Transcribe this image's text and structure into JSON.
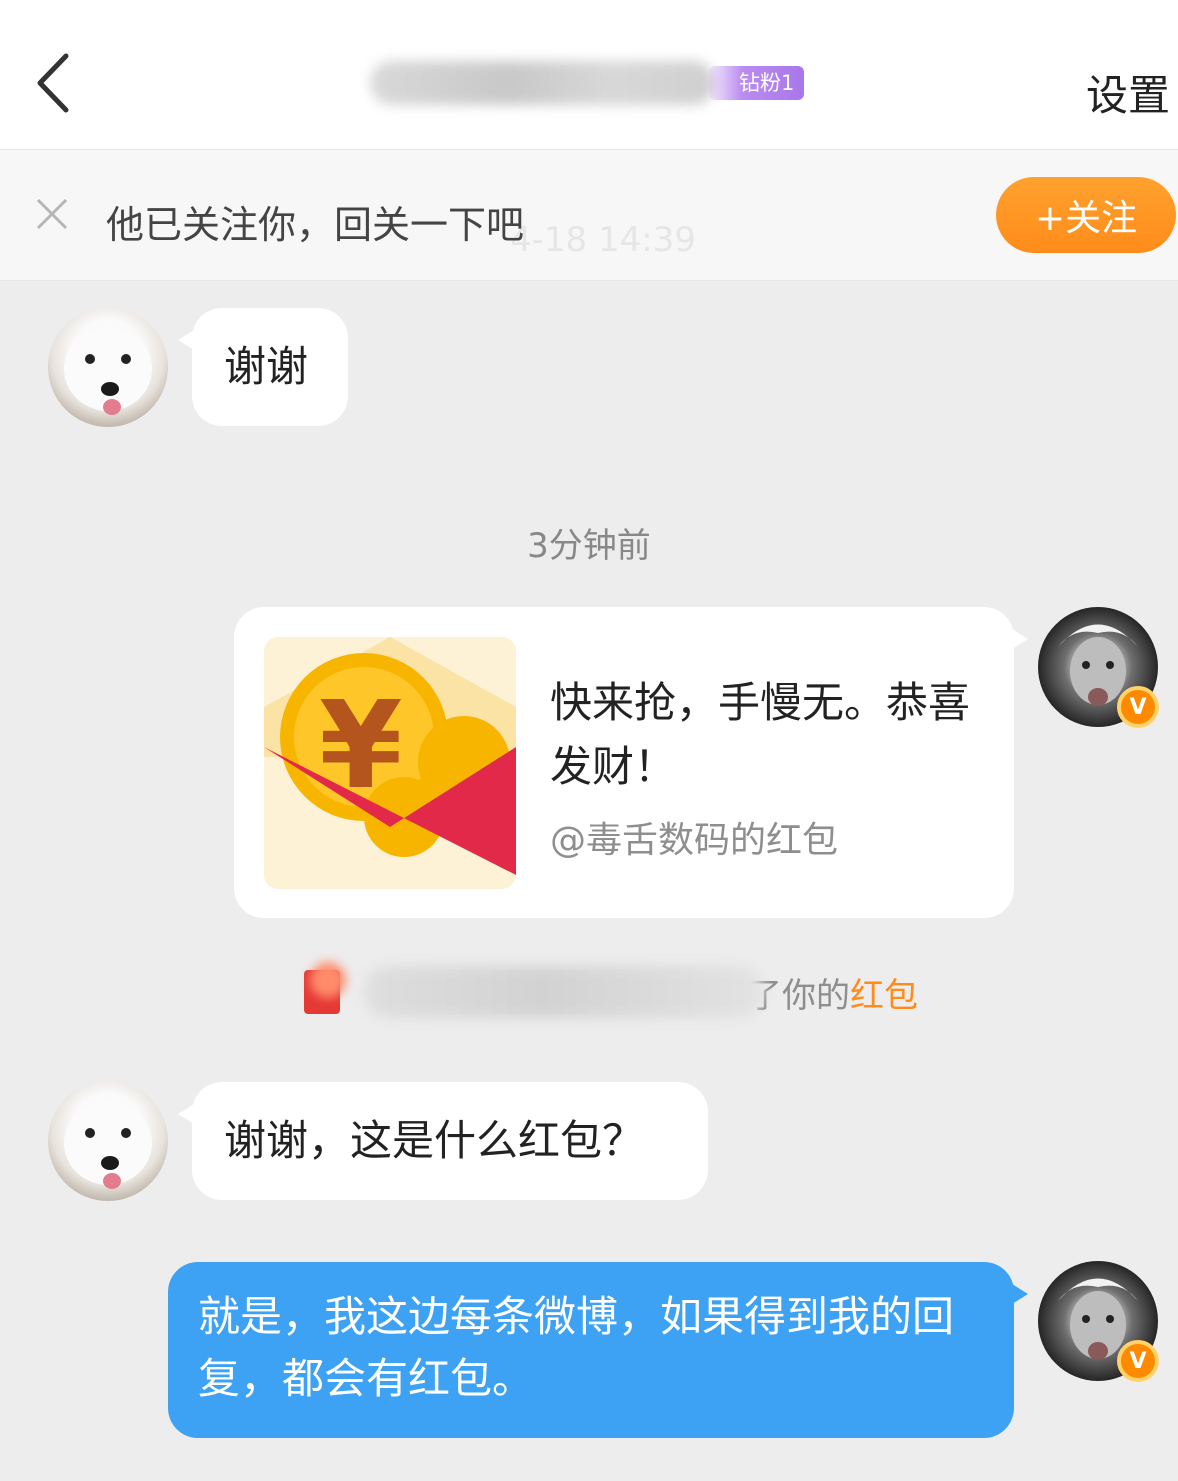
{
  "header": {
    "settings_label": "设置",
    "fan_badge": "钻粉1"
  },
  "banner": {
    "text": "他已关注你，回关一下吧",
    "follow_label": "+关注",
    "ghost_time": "4-18 14:39"
  },
  "messages": {
    "msg1": "谢谢",
    "timestamp": "3分钟前",
    "packet_title": "快来抢，手慢无。恭喜发财！",
    "packet_sub": "@毒舌数码的红包",
    "system_note_text": "了你的",
    "system_note_link": "红包",
    "msg2": "谢谢，这是什么红包？",
    "msg3": "就是，我这边每条微博，如果得到我的回复，都会有红包。"
  },
  "badges": {
    "verified": "V"
  },
  "colors": {
    "accent_orange": "#ff8c1a",
    "bubble_blue": "#3ea2f4",
    "packet_red": "#e2294a",
    "fan_badge_purple": "#b98cf0"
  }
}
